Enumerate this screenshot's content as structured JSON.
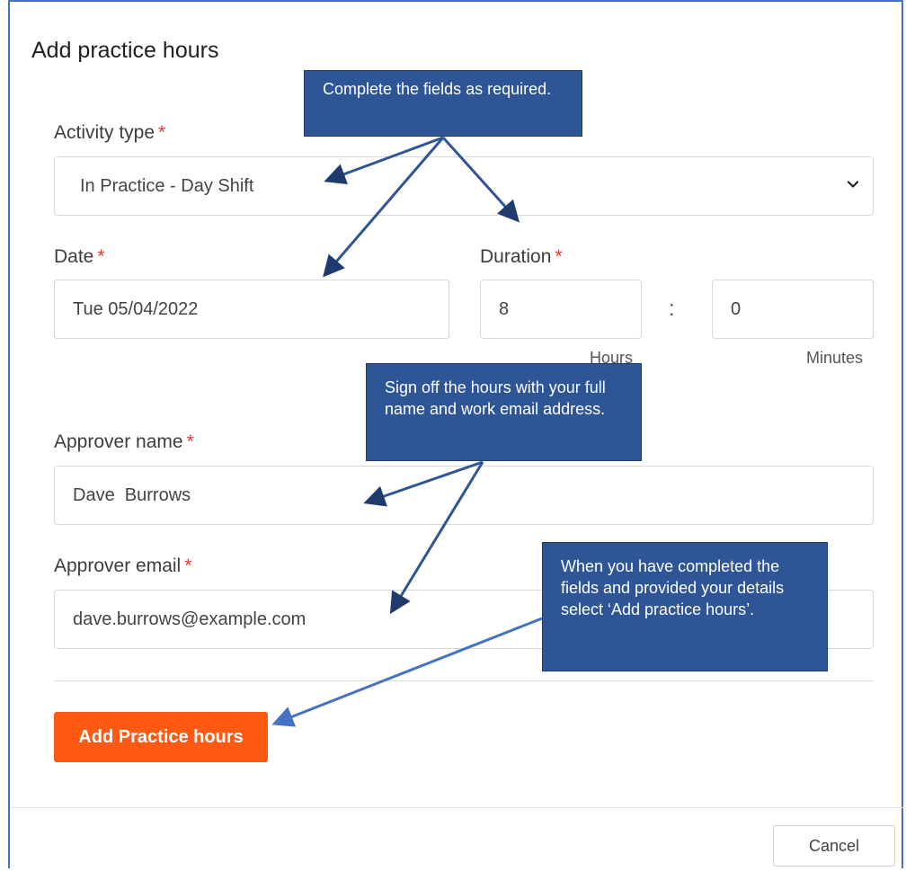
{
  "dialog": {
    "title": "Add practice hours"
  },
  "form": {
    "activity_type": {
      "label": "Activity type",
      "required": "*",
      "value": "In Practice - Day Shift"
    },
    "date": {
      "label": "Date",
      "required": "*",
      "value": "Tue 05/04/2022"
    },
    "duration": {
      "label": "Duration",
      "required": "*",
      "hours_value": "8",
      "separator": ":",
      "minutes_value": "0",
      "hours_label": "Hours",
      "minutes_label": "Minutes"
    },
    "approver_name": {
      "label": "Approver name",
      "required": "*",
      "value": "Dave  Burrows"
    },
    "approver_email": {
      "label": "Approver email",
      "required": "*",
      "value": "dave.burrows@example.com"
    }
  },
  "actions": {
    "submit_label": "Add Practice hours",
    "cancel_label": "Cancel"
  },
  "callouts": {
    "fields": "Complete the fields as required.",
    "sign_off": "Sign off the hours with your full name and work email address.",
    "submit": "When you have completed the fields and provided your details select ‘Add practice hours’."
  },
  "colors": {
    "accent_button": "#ff5a14",
    "callout_bg": "#2e5596",
    "required_marker": "#e23a2e",
    "frame_border": "#4472c4"
  },
  "icons": {
    "select_chevron": "chevron-down-icon"
  }
}
